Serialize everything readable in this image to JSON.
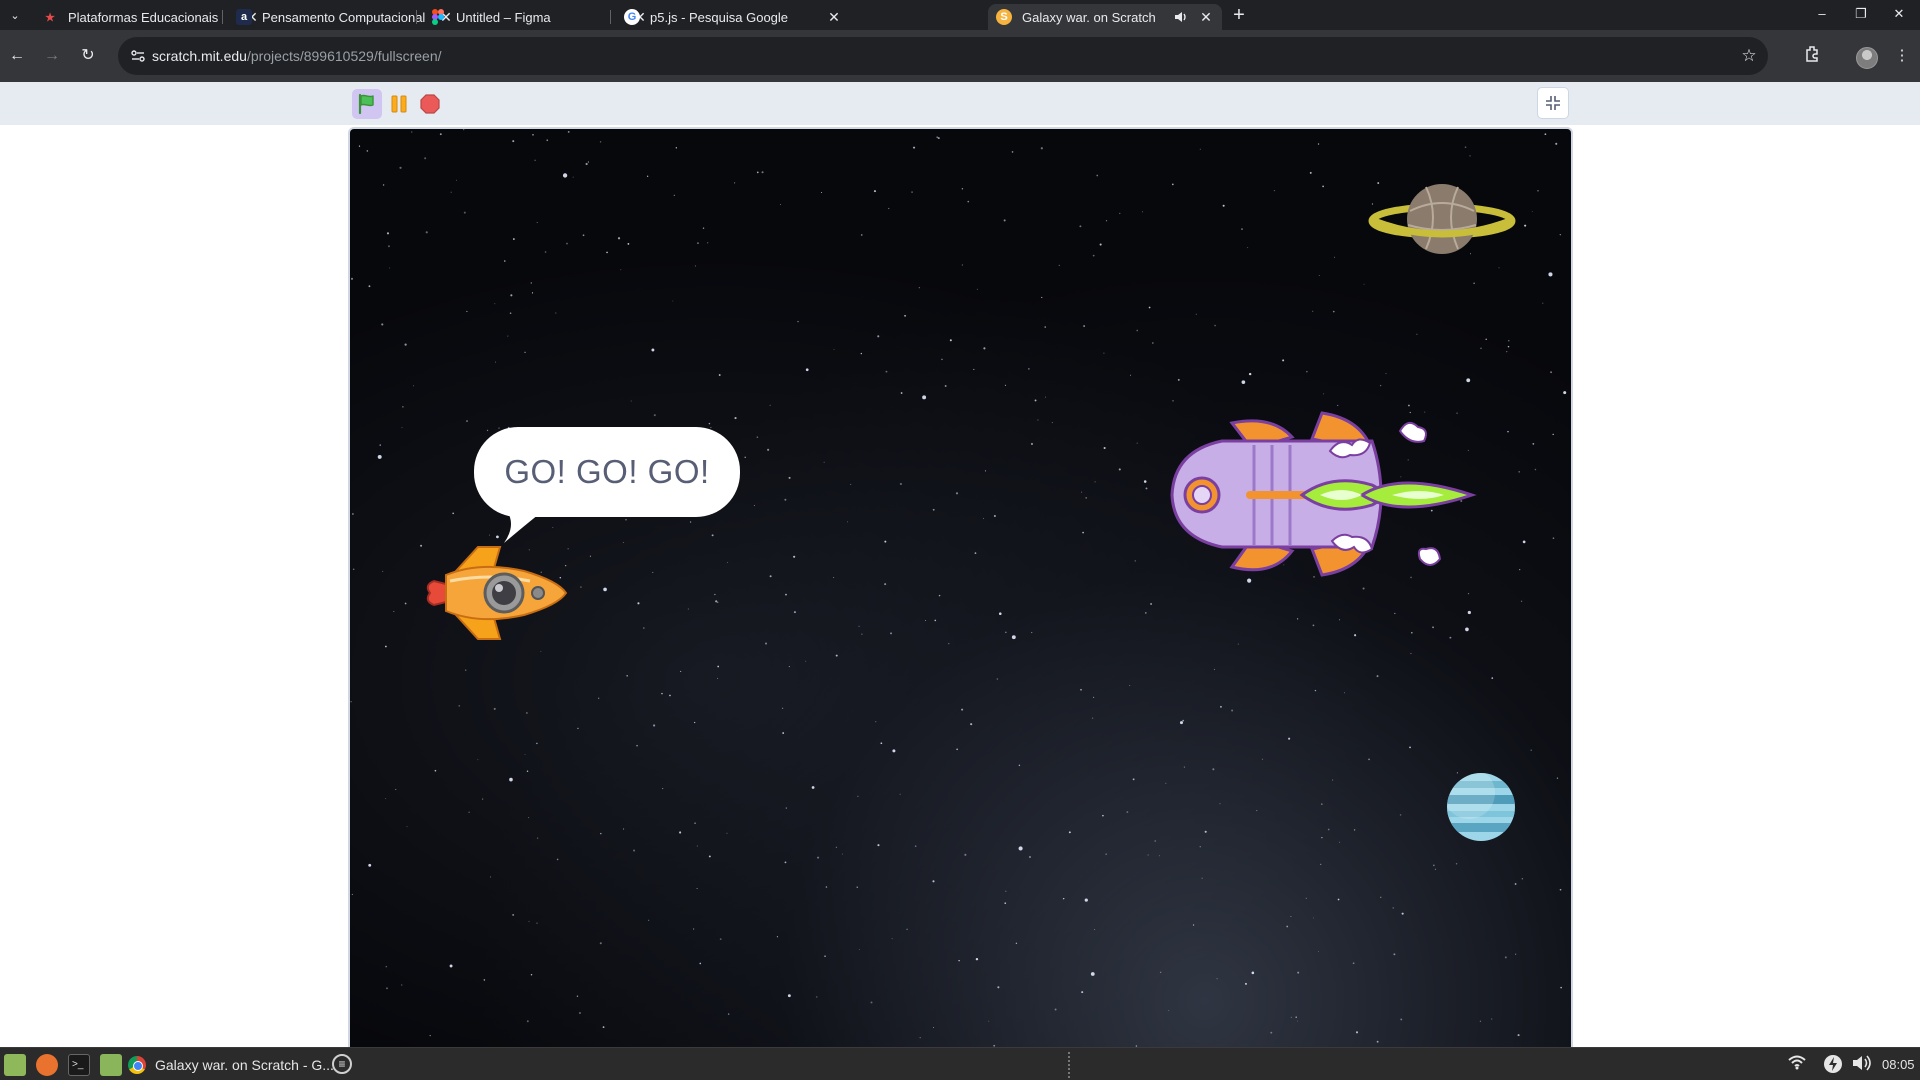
{
  "browser": {
    "tabs": [
      {
        "title": "Plataformas Educacionais",
        "favicon": "trophy-icon",
        "active": false
      },
      {
        "title": "Pensamento Computacional",
        "favicon": "a-letter-icon",
        "active": false
      },
      {
        "title": "Untitled – Figma",
        "favicon": "figma-icon",
        "active": false
      },
      {
        "title": "p5.js - Pesquisa Google",
        "favicon": "google-icon",
        "active": false
      },
      {
        "title": "Galaxy war. on Scratch",
        "favicon": "scratch-cat-icon",
        "active": true,
        "audio": true
      }
    ],
    "url_host": "scratch.mit.edu",
    "url_path": "/projects/899610529/fullscreen/"
  },
  "player": {
    "speech_bubble": "GO! GO! GO!",
    "colors": {
      "stage_bg": "#07080c",
      "toolbar_bg": "#e6ebf2",
      "flag_green": "#4cbf56",
      "pause_orange": "#ffab19",
      "stop_red": "#ec5959"
    }
  },
  "taskbar": {
    "app_title": "Galaxy war. on Scratch - G...",
    "clock": "08:05"
  }
}
